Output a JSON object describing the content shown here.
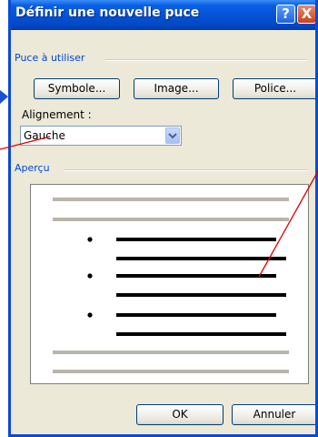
{
  "window": {
    "title": "Définir une nouvelle puce",
    "help_label": "?",
    "close_label": "X"
  },
  "bullet_group": {
    "label": "Puce à utiliser",
    "buttons": [
      {
        "label": "Symbole..."
      },
      {
        "label": "Image..."
      },
      {
        "label": "Police..."
      }
    ]
  },
  "alignment": {
    "label": "Alignement :",
    "selected": "Gauche"
  },
  "preview": {
    "label": "Aperçu",
    "bullet_count": 3
  },
  "footer": {
    "ok_label": "OK",
    "cancel_label": "Annuler"
  },
  "colors": {
    "title_bar": "#0553d6",
    "dialog_bg": "#ece9d8",
    "group_label": "#0046d5",
    "annotation": "#e00000",
    "preview_gray_line": "#b9b5ab"
  }
}
